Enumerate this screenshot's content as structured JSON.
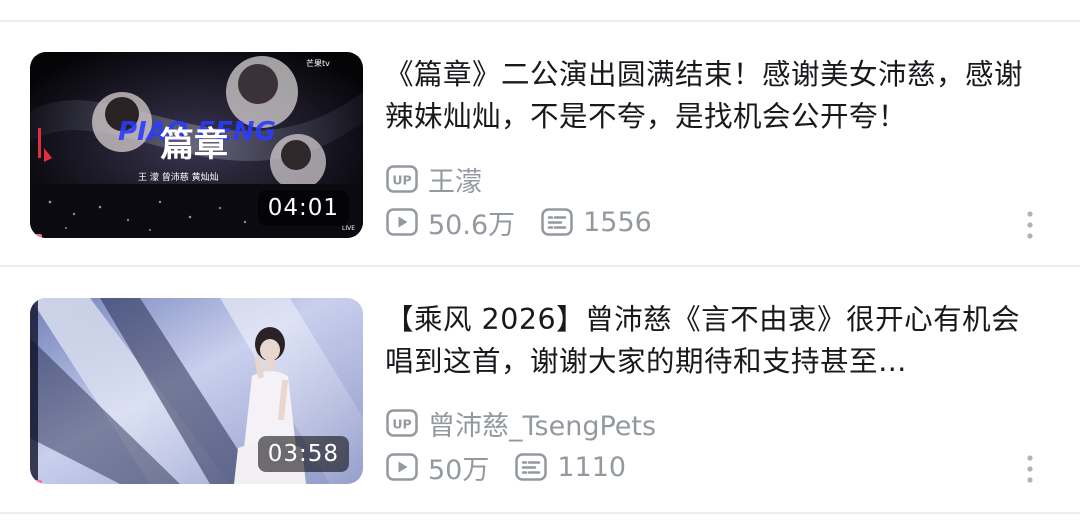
{
  "videos": [
    {
      "title": "《篇章》二公演出圆满结束！感谢美女沛慈，感谢辣妹灿灿，不是不夸，是找机会公开夸！",
      "duration": "04:01",
      "uploader": "王濛",
      "views": "50.6万",
      "danmaku": "1556",
      "thumb_texts": {
        "brand": "芒果tv",
        "headline": "篇章",
        "script_overlay": "PIAO FENG",
        "performers": "王 濛 曾沛慈 黄灿灿",
        "live": "LIVE"
      }
    },
    {
      "title": "【乘风 2026】曾沛慈《言不由衷》很开心有机会唱到这首，谢谢大家的期待和支持甚至…",
      "duration": "03:58",
      "uploader": "曾沛慈_TsengPets",
      "views": "50万",
      "danmaku": "1110"
    }
  ],
  "icons": {
    "uploader": "up-badge-icon",
    "views": "play-count-icon",
    "danmaku": "danmaku-icon",
    "more": "more-vertical-icon"
  },
  "colors": {
    "title": "#18191c",
    "meta": "#9499a0",
    "accent": "#fb7299"
  }
}
